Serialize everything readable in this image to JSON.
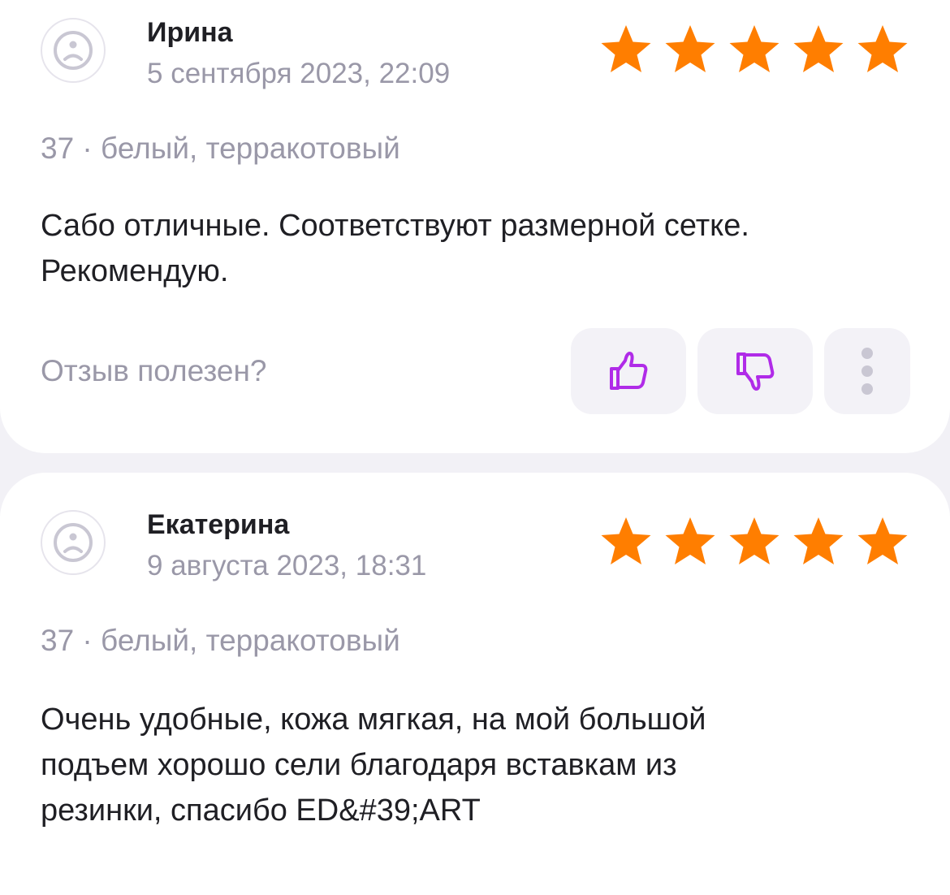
{
  "colors": {
    "star": "#ff7e00",
    "accent": "#b02be8",
    "muted_text": "#9a98a8",
    "primary_text": "#1f1f24",
    "background": "#f2f1f6"
  },
  "reviews": [
    {
      "author": "Ирина",
      "date": "5 сентября 2023, 22:09",
      "rating": 5,
      "variant": "37 · белый, терракотовый",
      "text": "Сабо отличные. Соответствуют размерной сетке.\nРекомендую.",
      "helpful_label": "Отзыв полезен?",
      "icons": {
        "avatar": "sad-face-icon",
        "like": "thumbs-up-icon",
        "dislike": "thumbs-down-icon",
        "more": "more-vertical-icon"
      }
    },
    {
      "author": "Екатерина",
      "date": "9 августа 2023, 18:31",
      "rating": 5,
      "variant": "37 · белый, терракотовый",
      "text": "Очень удобные, кожа мягкая, на мой большой\nподъем хорошо сели благодаря вставкам из\nрезинки, спасибо ED&#39;ART",
      "icons": {
        "avatar": "sad-face-icon"
      }
    }
  ]
}
